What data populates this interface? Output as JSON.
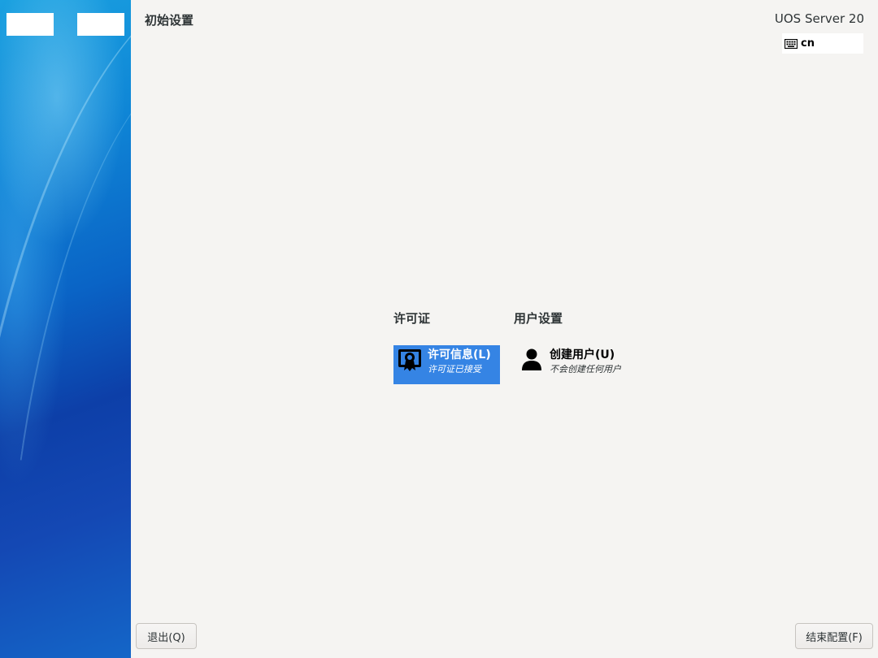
{
  "header": {
    "title": "初始设置",
    "product": "UOS Server 20",
    "keyboard_layout": "cn",
    "keyboard_icon": "keyboard-icon"
  },
  "categories": [
    {
      "title": "许可证",
      "spokes": [
        {
          "title": "许可信息(L)",
          "status": "许可证已接受",
          "icon": "license-certificate-icon",
          "selected": true
        }
      ]
    },
    {
      "title": "用户设置",
      "spokes": [
        {
          "title": "创建用户(U)",
          "status": "不会创建任何用户",
          "icon": "user-icon",
          "selected": false
        }
      ]
    }
  ],
  "footer": {
    "quit_label": "退出(Q)",
    "finish_label": "结束配置(F)"
  },
  "colors": {
    "selected_spoke": "#3584e4",
    "background": "#f5f4f2",
    "sidebar_blue": "#0a64c6"
  }
}
